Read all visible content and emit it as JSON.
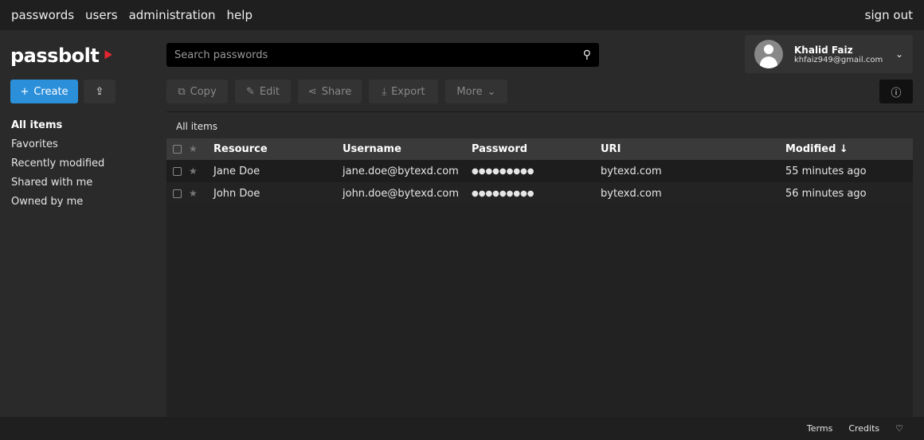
{
  "nav": {
    "items": [
      "passwords",
      "users",
      "administration",
      "help"
    ],
    "sign_out": "sign out"
  },
  "logo": "passbolt",
  "search": {
    "placeholder": "Search passwords"
  },
  "user": {
    "name": "Khalid Faiz",
    "email": "khfaiz949@gmail.com"
  },
  "toolbar": {
    "create": "Create",
    "copy": "Copy",
    "edit": "Edit",
    "share": "Share",
    "export": "Export",
    "more": "More"
  },
  "sidebar": {
    "items": [
      "All items",
      "Favorites",
      "Recently modified",
      "Shared with me",
      "Owned by me"
    ]
  },
  "breadcrumb": "All items",
  "table": {
    "headers": [
      "Resource",
      "Username",
      "Password",
      "URI",
      "Modified ↓"
    ],
    "rows": [
      {
        "resource": "Jane Doe",
        "username": "jane.doe@bytexd.com",
        "password": "●●●●●●●●●",
        "uri": "bytexd.com",
        "modified": "55 minutes ago"
      },
      {
        "resource": "John Doe",
        "username": "john.doe@bytexd.com",
        "password": "●●●●●●●●●",
        "uri": "bytexd.com",
        "modified": "56 minutes ago"
      }
    ]
  },
  "footer": {
    "terms": "Terms",
    "credits": "Credits"
  },
  "colors": {
    "accent": "#2c8fd9",
    "brand": "#e3262f"
  }
}
